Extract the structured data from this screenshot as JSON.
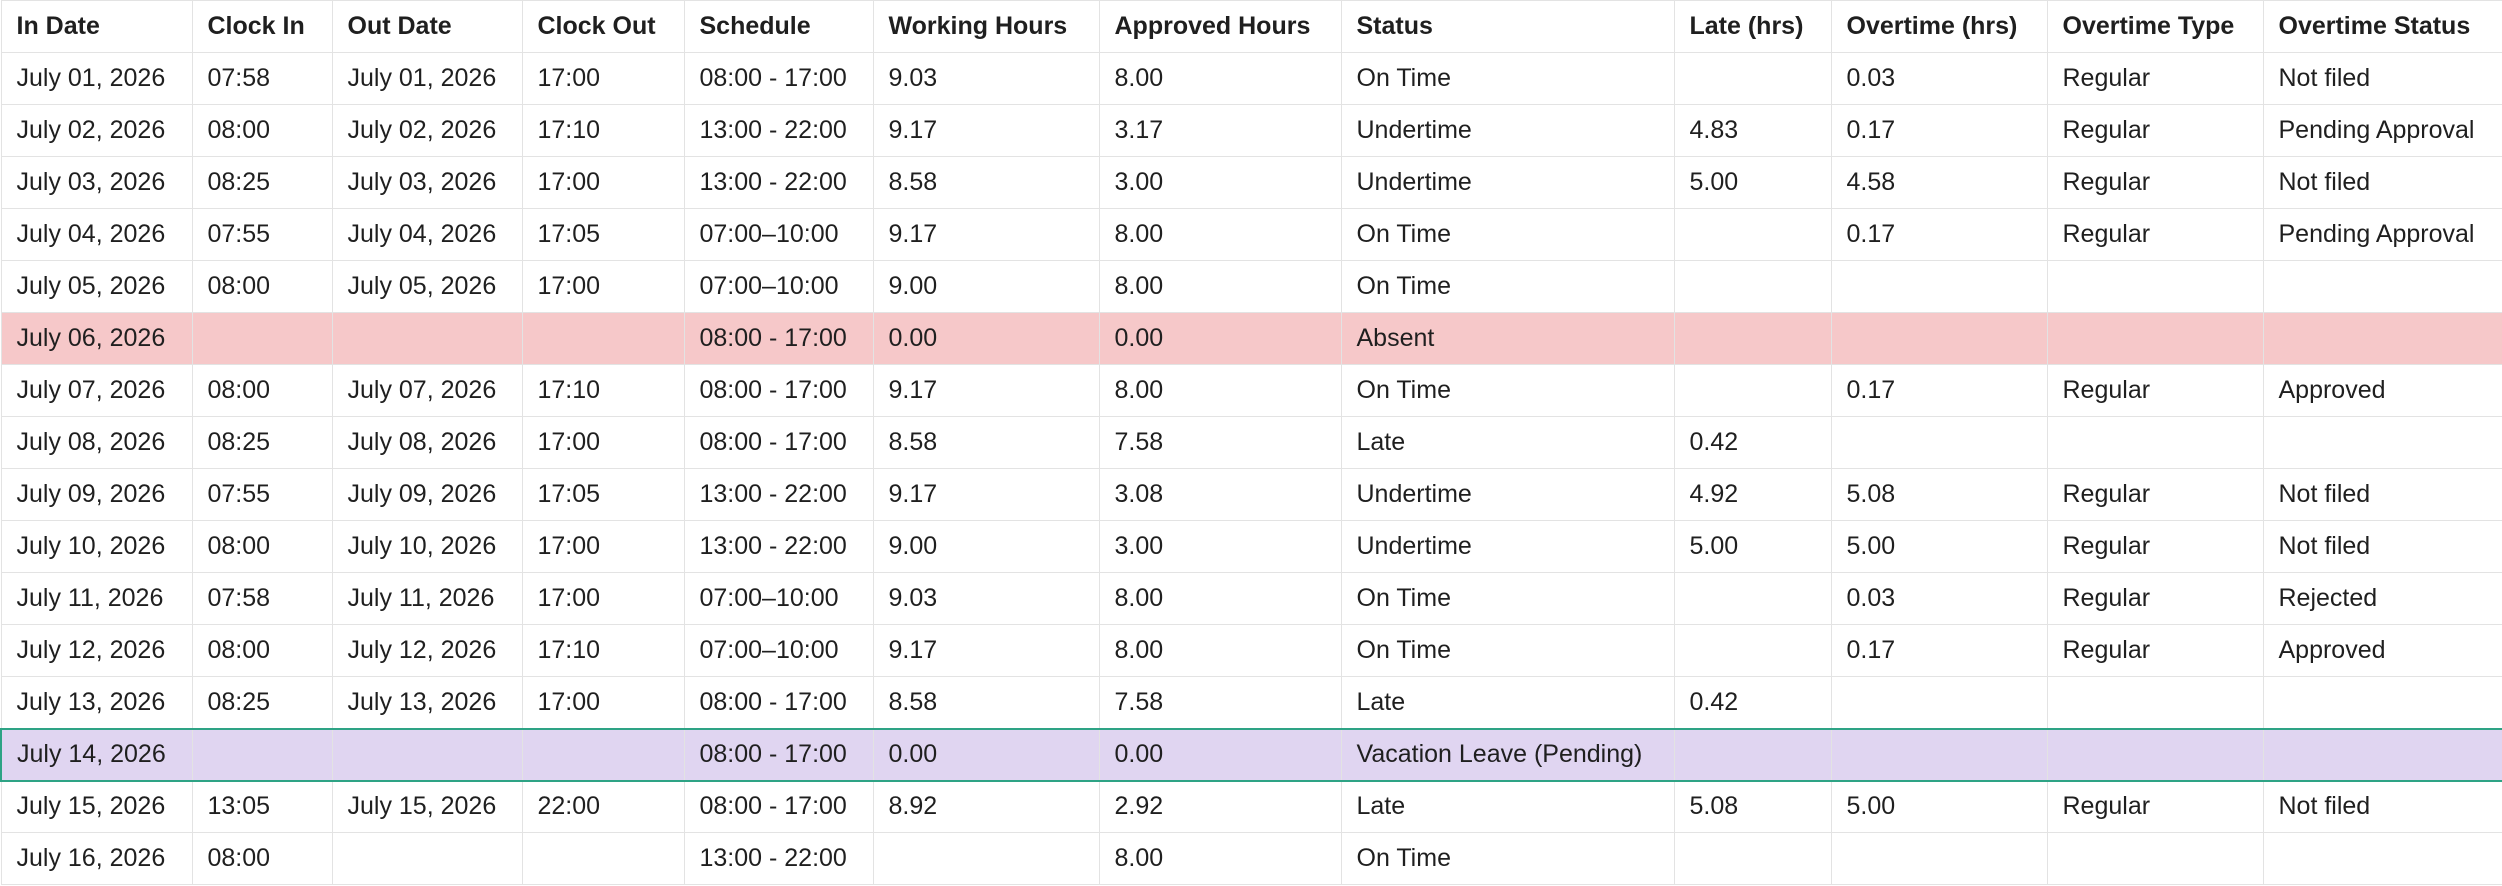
{
  "columns": [
    "In Date",
    "Clock In",
    "Out Date",
    "Clock Out",
    "Schedule",
    "Working Hours",
    "Approved Hours",
    "Status",
    "Late (hrs)",
    "Overtime (hrs)",
    "Overtime Type",
    "Overtime Status"
  ],
  "rows": [
    {
      "in_date": "July 01, 2026",
      "clock_in": "07:58",
      "out_date": "July 01, 2026",
      "clock_out": "17:00",
      "schedule": "08:00 - 17:00",
      "working_hours": "9.03",
      "approved_hours": "8.00",
      "status": "On Time",
      "late": "",
      "overtime": "0.03",
      "ot_type": "Regular",
      "ot_status": "Not filed"
    },
    {
      "in_date": "July 02, 2026",
      "clock_in": "08:00",
      "out_date": "July 02, 2026",
      "clock_out": "17:10",
      "schedule": "13:00 - 22:00",
      "working_hours": "9.17",
      "approved_hours": "3.17",
      "status": "Undertime",
      "late": "4.83",
      "overtime": "0.17",
      "ot_type": "Regular",
      "ot_status": "Pending Approval"
    },
    {
      "in_date": "July 03, 2026",
      "clock_in": "08:25",
      "out_date": "July 03, 2026",
      "clock_out": "17:00",
      "schedule": "13:00 - 22:00",
      "working_hours": "8.58",
      "approved_hours": "3.00",
      "status": "Undertime",
      "late": "5.00",
      "overtime": "4.58",
      "ot_type": "Regular",
      "ot_status": "Not filed"
    },
    {
      "in_date": "July 04, 2026",
      "clock_in": "07:55",
      "out_date": "July 04, 2026",
      "clock_out": "17:05",
      "schedule": "07:00–10:00",
      "working_hours": "9.17",
      "approved_hours": "8.00",
      "status": "On Time",
      "late": "",
      "overtime": "0.17",
      "ot_type": "Regular",
      "ot_status": "Pending Approval"
    },
    {
      "in_date": "July 05, 2026",
      "clock_in": "08:00",
      "out_date": "July 05, 2026",
      "clock_out": "17:00",
      "schedule": "07:00–10:00",
      "working_hours": "9.00",
      "approved_hours": "8.00",
      "status": "On Time",
      "late": "",
      "overtime": "",
      "ot_type": "",
      "ot_status": ""
    },
    {
      "in_date": "July 06, 2026",
      "clock_in": "",
      "out_date": "",
      "clock_out": "",
      "schedule": "08:00 - 17:00",
      "working_hours": "0.00",
      "approved_hours": "0.00",
      "status": "Absent",
      "late": "",
      "overtime": "",
      "ot_type": "",
      "ot_status": ""
    },
    {
      "in_date": "July 07, 2026",
      "clock_in": "08:00",
      "out_date": "July 07, 2026",
      "clock_out": "17:10",
      "schedule": "08:00 - 17:00",
      "working_hours": "9.17",
      "approved_hours": "8.00",
      "status": "On Time",
      "late": "",
      "overtime": "0.17",
      "ot_type": "Regular",
      "ot_status": "Approved"
    },
    {
      "in_date": "July 08, 2026",
      "clock_in": "08:25",
      "out_date": "July 08, 2026",
      "clock_out": "17:00",
      "schedule": "08:00 - 17:00",
      "working_hours": "8.58",
      "approved_hours": "7.58",
      "status": "Late",
      "late": "0.42",
      "overtime": "",
      "ot_type": "",
      "ot_status": ""
    },
    {
      "in_date": "July 09, 2026",
      "clock_in": "07:55",
      "out_date": "July 09, 2026",
      "clock_out": "17:05",
      "schedule": "13:00 - 22:00",
      "working_hours": "9.17",
      "approved_hours": "3.08",
      "status": "Undertime",
      "late": "4.92",
      "overtime": "5.08",
      "ot_type": "Regular",
      "ot_status": "Not filed"
    },
    {
      "in_date": "July 10, 2026",
      "clock_in": "08:00",
      "out_date": "July 10, 2026",
      "clock_out": "17:00",
      "schedule": "13:00 - 22:00",
      "working_hours": "9.00",
      "approved_hours": "3.00",
      "status": "Undertime",
      "late": "5.00",
      "overtime": "5.00",
      "ot_type": "Regular",
      "ot_status": "Not filed"
    },
    {
      "in_date": "July 11, 2026",
      "clock_in": "07:58",
      "out_date": "July 11, 2026",
      "clock_out": "17:00",
      "schedule": "07:00–10:00",
      "working_hours": "9.03",
      "approved_hours": "8.00",
      "status": "On Time",
      "late": "",
      "overtime": "0.03",
      "ot_type": "Regular",
      "ot_status": "Rejected"
    },
    {
      "in_date": "July 12, 2026",
      "clock_in": "08:00",
      "out_date": "July 12, 2026",
      "clock_out": "17:10",
      "schedule": "07:00–10:00",
      "working_hours": "9.17",
      "approved_hours": "8.00",
      "status": "On Time",
      "late": "",
      "overtime": "0.17",
      "ot_type": "Regular",
      "ot_status": "Approved"
    },
    {
      "in_date": "July 13, 2026",
      "clock_in": "08:25",
      "out_date": "July 13, 2026",
      "clock_out": "17:00",
      "schedule": "08:00 - 17:00",
      "working_hours": "8.58",
      "approved_hours": "7.58",
      "status": "Late",
      "late": "0.42",
      "overtime": "",
      "ot_type": "",
      "ot_status": ""
    },
    {
      "in_date": "July 14, 2026",
      "clock_in": "",
      "out_date": "",
      "clock_out": "",
      "schedule": "08:00 - 17:00",
      "working_hours": "0.00",
      "approved_hours": "0.00",
      "status": "Vacation Leave (Pending)",
      "late": "",
      "overtime": "",
      "ot_type": "",
      "ot_status": ""
    },
    {
      "in_date": "July 15, 2026",
      "clock_in": "13:05",
      "out_date": "July 15, 2026",
      "clock_out": "22:00",
      "schedule": "08:00 - 17:00",
      "working_hours": "8.92",
      "approved_hours": "2.92",
      "status": "Late",
      "late": "5.08",
      "overtime": "5.00",
      "ot_type": "Regular",
      "ot_status": "Not filed"
    },
    {
      "in_date": "July 16, 2026",
      "clock_in": "08:00",
      "out_date": "",
      "clock_out": "",
      "schedule": "13:00 - 22:00",
      "working_hours": "",
      "approved_hours": "8.00",
      "status": "On Time",
      "late": "",
      "overtime": "",
      "ot_type": "",
      "ot_status": ""
    }
  ],
  "colors": {
    "absent_row": "#f6c8c9",
    "selected_row": "#e0d5f1",
    "selected_border": "#2ea385",
    "grid": "#e3e3e3"
  }
}
